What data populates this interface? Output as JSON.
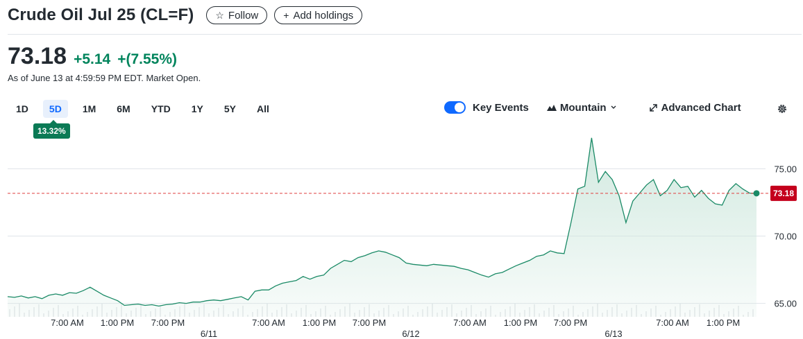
{
  "header": {
    "title": "Crude Oil Jul 25 (CL=F)",
    "follow_label": "Follow",
    "add_holdings_label": "Add holdings"
  },
  "quote": {
    "price": "73.18",
    "change": "+5.14",
    "change_pct": "+(7.55%)",
    "as_of": "As of June 13 at 4:59:59 PM EDT. Market Open."
  },
  "ranges": [
    "1D",
    "5D",
    "1M",
    "6M",
    "YTD",
    "1Y",
    "5Y",
    "All"
  ],
  "active_range": "5D",
  "range_change_badge": "13.32%",
  "controls": {
    "key_events_label": "Key Events",
    "key_events_on": true,
    "chart_type_label": "Mountain",
    "advanced_chart_label": "Advanced Chart"
  },
  "icons": {
    "follow": "star-icon",
    "add": "plus-icon",
    "mountain": "mountain-icon",
    "chevron": "chevron-down-icon",
    "advanced": "expand-arrows-icon",
    "settings": "gear-icon"
  },
  "colors": {
    "positive": "#00845c",
    "line": "#1a8a66",
    "area_top": "#cfe8de",
    "reference_line": "#e03d3d",
    "last_price_badge": "#c4001c",
    "active_range": "#0f69ff"
  },
  "chart_data": {
    "type": "area",
    "ylim": [
      64,
      77.5
    ],
    "y_ticks": [
      65,
      70,
      75
    ],
    "y_tick_labels": [
      "65.00",
      "70.00",
      "75.00"
    ],
    "reference_value": 73.18,
    "last_value_label": "73.18",
    "x_tick_labels": [
      "7:00 AM",
      "1:00 PM",
      "7:00 PM",
      "7:00 AM",
      "1:00 PM",
      "7:00 PM",
      "7:00 AM",
      "1:00 PM",
      "7:00 PM",
      "7:00 AM",
      "1:00 PM"
    ],
    "date_labels": [
      "6/11",
      "6/12",
      "6/13"
    ],
    "series": [
      {
        "values": [
          65.5,
          65.45,
          65.55,
          65.4,
          65.5,
          65.35,
          65.6,
          65.7,
          65.6,
          65.8,
          65.75,
          65.95,
          66.2,
          65.9,
          65.6,
          65.4,
          65.2,
          64.85,
          64.9,
          64.95,
          64.85,
          64.9,
          64.8,
          64.9,
          64.95,
          65.05,
          65.0,
          65.1,
          65.1,
          65.2,
          65.25,
          65.2,
          65.3,
          65.4,
          65.5,
          65.25,
          65.9,
          66.0,
          66.0,
          66.3,
          66.5,
          66.6,
          66.7,
          67.0,
          66.8,
          67.0,
          67.1,
          67.6,
          67.9,
          68.2,
          68.1,
          68.4,
          68.55,
          68.75,
          68.9,
          68.8,
          68.6,
          68.4,
          68.0,
          67.9,
          67.85,
          67.8,
          67.9,
          67.85,
          67.8,
          67.75,
          67.6,
          67.5,
          67.3,
          67.1,
          66.95,
          67.2,
          67.3,
          67.55,
          67.8,
          68.0,
          68.2,
          68.5,
          68.6,
          68.9,
          68.75,
          68.7,
          71.0,
          73.5,
          73.7,
          77.3,
          74.0,
          74.8,
          74.2,
          73.0,
          71.0,
          72.6,
          73.2,
          73.8,
          74.2,
          73.0,
          73.4,
          74.2,
          73.6,
          73.7,
          72.9,
          73.4,
          72.8,
          72.4,
          72.3,
          73.4,
          73.9,
          73.5,
          73.2,
          73.18
        ]
      }
    ]
  }
}
